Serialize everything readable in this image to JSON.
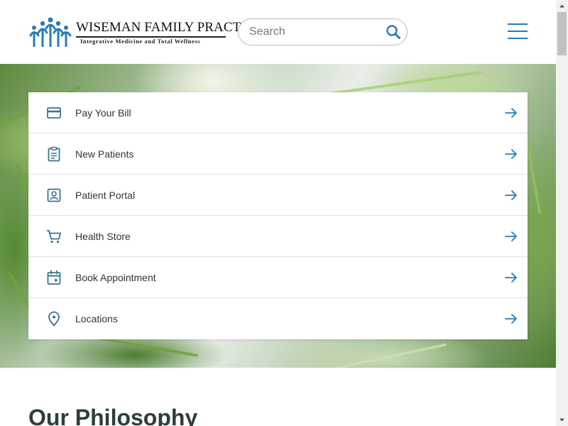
{
  "header": {
    "logo": {
      "title": "WISEMAN FAMILY PRACTICE",
      "tagline": "Integrative Medicine and Total Wellness"
    },
    "search": {
      "placeholder": "Search",
      "value": "",
      "icon": "search-icon"
    },
    "menu_icon": "hamburger-menu-icon"
  },
  "quick_links": [
    {
      "label": "Pay Your Bill",
      "icon": "credit-card-icon"
    },
    {
      "label": "New Patients",
      "icon": "clipboard-icon"
    },
    {
      "label": "Patient Portal",
      "icon": "portrait-icon"
    },
    {
      "label": "Health Store",
      "icon": "cart-icon"
    },
    {
      "label": "Book Appointment",
      "icon": "calendar-icon"
    },
    {
      "label": "Locations",
      "icon": "map-pin-icon"
    }
  ],
  "main": {
    "section_heading": "Our Philosophy"
  },
  "colors": {
    "accent": "#2b7bb2",
    "icon": "#3a7396",
    "heading": "#2c3e3d"
  }
}
